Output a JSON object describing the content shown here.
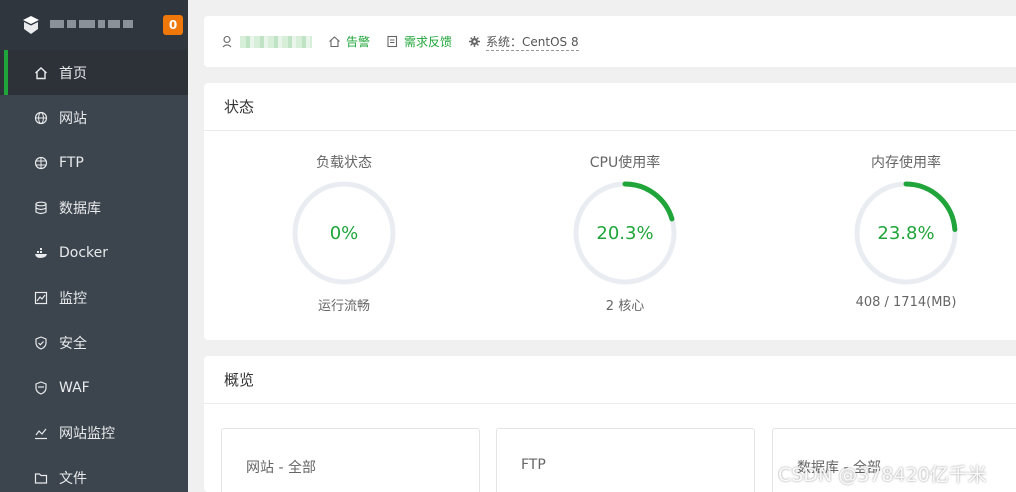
{
  "sidebar": {
    "badge": "0",
    "items": [
      {
        "label": "首页",
        "icon": "home-icon",
        "active": true
      },
      {
        "label": "网站",
        "icon": "globe-icon"
      },
      {
        "label": "FTP",
        "icon": "ftp-globe-icon"
      },
      {
        "label": "数据库",
        "icon": "database-icon"
      },
      {
        "label": "Docker",
        "icon": "docker-icon"
      },
      {
        "label": "监控",
        "icon": "monitor-chart-icon"
      },
      {
        "label": "安全",
        "icon": "shield-icon"
      },
      {
        "label": "WAF",
        "icon": "waf-shield-icon"
      },
      {
        "label": "网站监控",
        "icon": "site-monitor-icon"
      },
      {
        "label": "文件",
        "icon": "folder-icon"
      }
    ]
  },
  "topbar": {
    "alert_label": "告警",
    "feedback_label": "需求反馈",
    "system_label": "系统：CentOS 8"
  },
  "status": {
    "title": "状态",
    "gauges": [
      {
        "label": "负载状态",
        "value_text": "0%",
        "percent": 0,
        "sub": "运行流畅"
      },
      {
        "label": "CPU使用率",
        "value_text": "20.3%",
        "percent": 20.3,
        "sub": "2 核心"
      },
      {
        "label": "内存使用率",
        "value_text": "23.8%",
        "percent": 23.8,
        "sub": "408 / 1714(MB)"
      }
    ]
  },
  "overview": {
    "title": "概览",
    "cards": [
      "网站 - 全部",
      "FTP",
      "数据库 - 全部"
    ]
  },
  "watermark": "CSDN @378420亿千米",
  "colors": {
    "accent": "#20a53a",
    "track": "#e9edf2",
    "sidebar_bg": "#3c444d",
    "badge": "#f0780a"
  }
}
